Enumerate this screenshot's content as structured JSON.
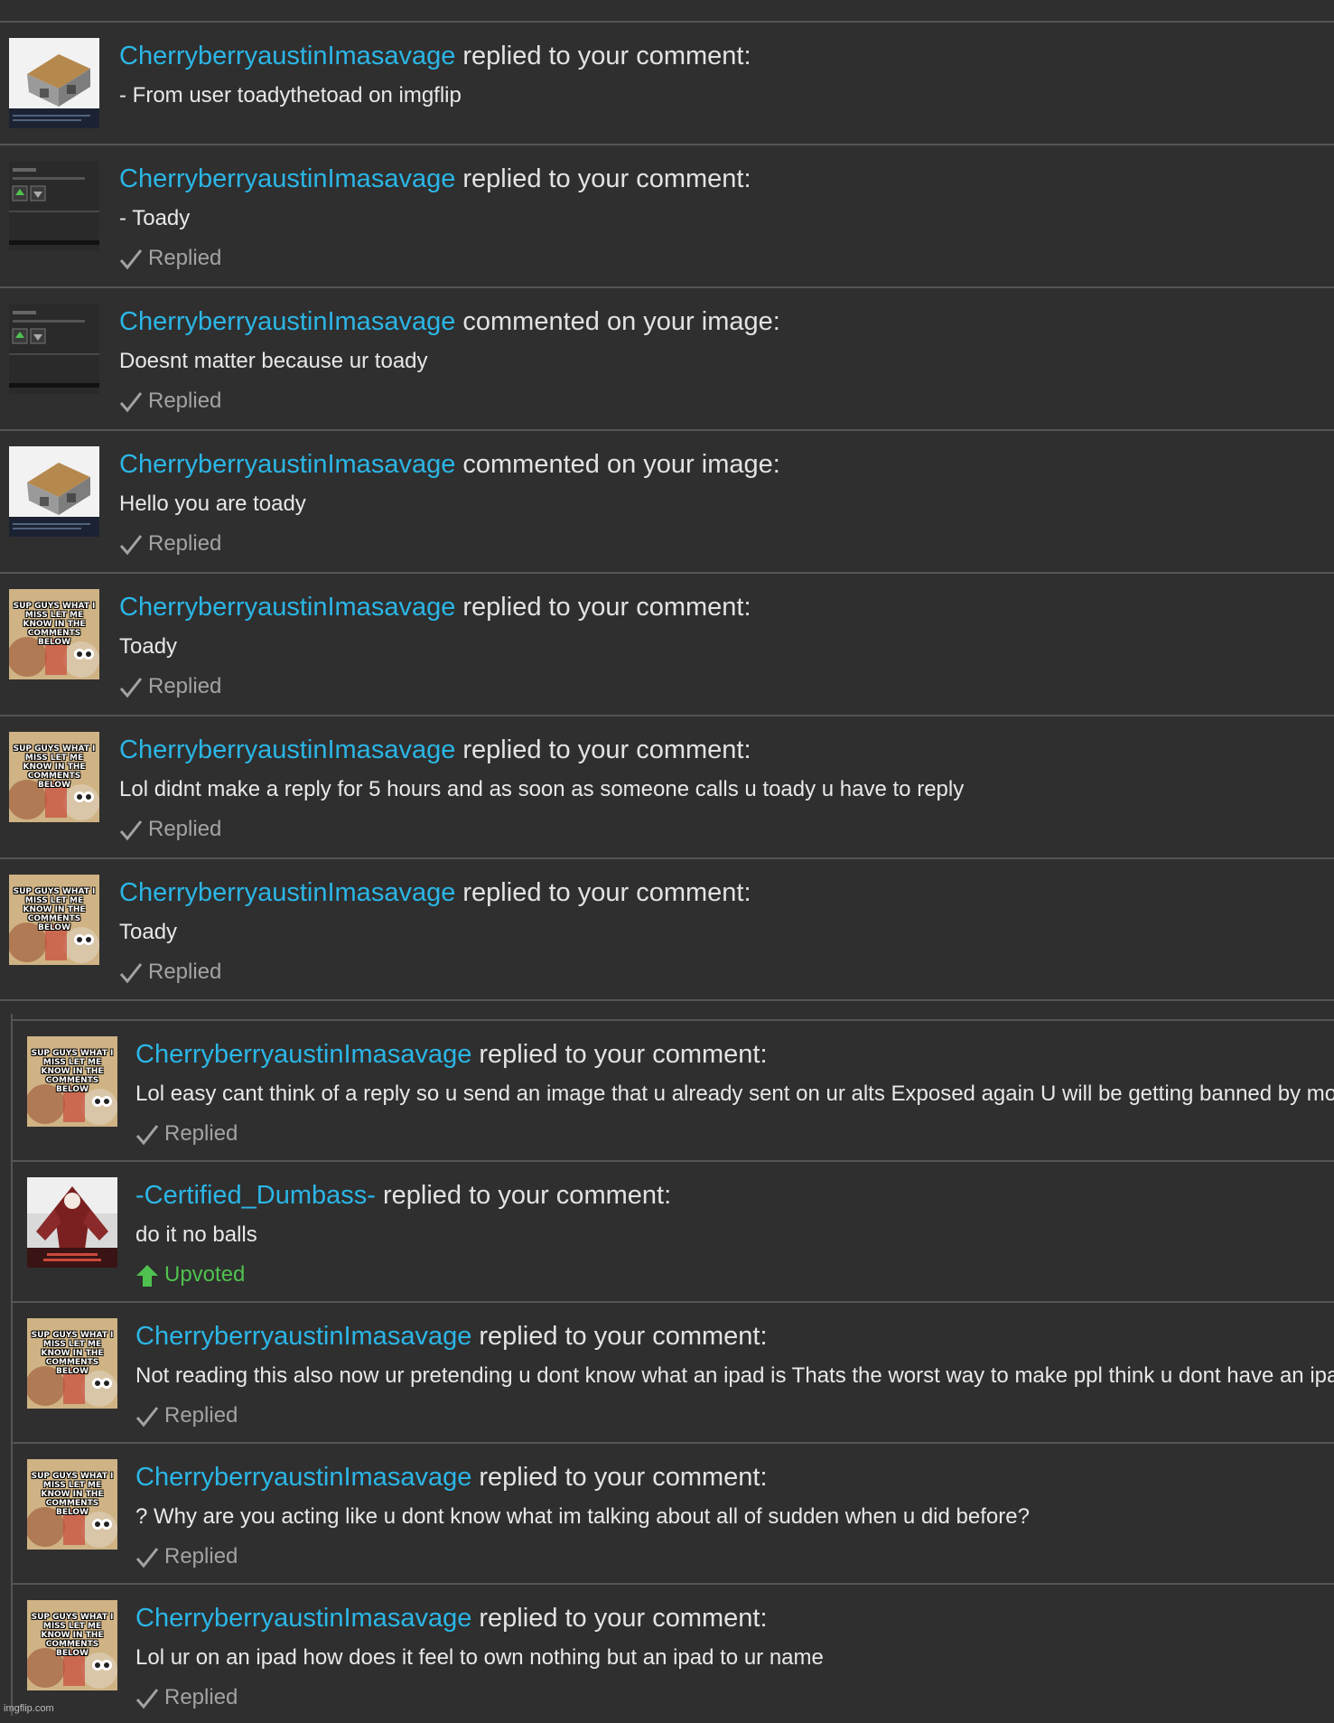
{
  "notifications": [
    {
      "user": "CherryberryaustinImasavage",
      "action": "replied to your comment:",
      "text": "- From user toadythetoad on imgflip",
      "status": "",
      "thumb": "house"
    },
    {
      "user": "CherryberryaustinImasavage",
      "action": "replied to your comment:",
      "text": "- Toady",
      "status": "Replied",
      "thumb": "screen"
    },
    {
      "user": "CherryberryaustinImasavage",
      "action": "commented on your image:",
      "text": "Doesnt matter because ur toady",
      "status": "Replied",
      "thumb": "screen"
    },
    {
      "user": "CherryberryaustinImasavage",
      "action": "commented on your image:",
      "text": "Hello you are toady",
      "status": "Replied",
      "thumb": "house"
    },
    {
      "user": "CherryberryaustinImasavage",
      "action": "replied to your comment:",
      "text": "Toady",
      "status": "Replied",
      "thumb": "meme"
    },
    {
      "user": "CherryberryaustinImasavage",
      "action": "replied to your comment:",
      "text": "Lol didnt make a reply for 5 hours and as soon as someone calls u toady u have to reply",
      "status": "Replied",
      "thumb": "meme"
    },
    {
      "user": "CherryberryaustinImasavage",
      "action": "replied to your comment:",
      "text": "Toady",
      "status": "Replied",
      "thumb": "meme"
    },
    {
      "user": "CherryberryaustinImasavage",
      "action": "replied to your comment:",
      "text": "Lol easy cant think of a reply so u send an image that u already sent on ur alts Exposed again U will be getting banned by mo",
      "status": "Replied",
      "thumb": "meme"
    },
    {
      "user": "-Certified_Dumbass-",
      "action": "replied to your comment:",
      "text": "do it no balls",
      "status": "Upvoted",
      "thumb": "demon"
    },
    {
      "user": "CherryberryaustinImasavage",
      "action": "replied to your comment:",
      "text": "Not reading this also now ur pretending u dont know what an ipad is Thats the worst way to make ppl think u dont have an ipa",
      "status": "Replied",
      "thumb": "meme"
    },
    {
      "user": "CherryberryaustinImasavage",
      "action": "replied to your comment:",
      "text": "? Why are you acting like u dont know what im talking about all of sudden when u did before?",
      "status": "Replied",
      "thumb": "meme"
    },
    {
      "user": "CherryberryaustinImasavage",
      "action": "replied to your comment:",
      "text": "Lol ur on an ipad how does it feel to own nothing but an ipad to ur name",
      "status": "Replied",
      "thumb": "meme"
    }
  ],
  "meme_caption": "SUP GUYS WHAT I MISS LET ME KNOW IN THE COMMENTS BELOW",
  "screenshot_thumb": {
    "by": "by: glory",
    "stats": "0 views, 2 upvotes, 10 com"
  },
  "watermark": "imgflip.com",
  "colors": {
    "background": "#2f2f2f",
    "username": "#2bb6e6",
    "replied": "#a3a3a3",
    "upvoted": "#4fc24f",
    "divider": "#555555"
  }
}
